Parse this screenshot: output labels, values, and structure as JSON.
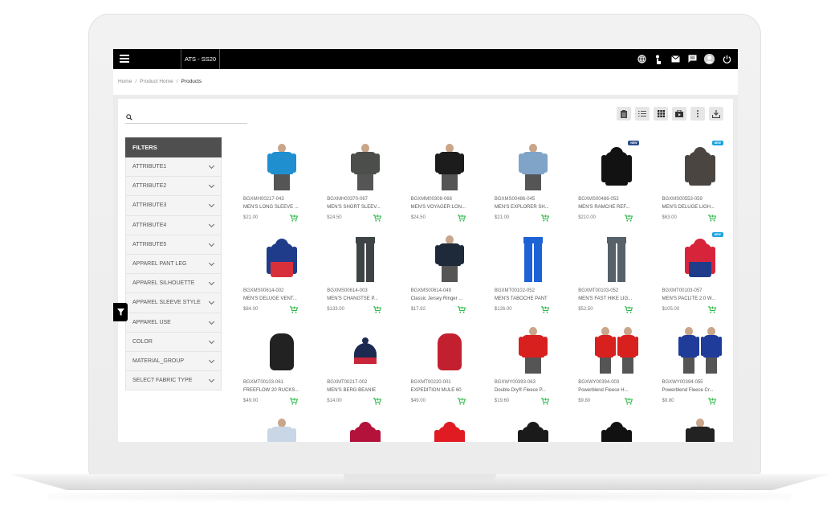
{
  "topbar": {
    "season": "ATS - SS20",
    "icons": [
      "globe-icon",
      "touch-icon",
      "mail-icon",
      "chat-icon",
      "avatar",
      "power-icon"
    ]
  },
  "breadcrumb": {
    "items": [
      "Home",
      "Product Home"
    ],
    "current": "Products"
  },
  "search": {
    "placeholder": "",
    "value": ""
  },
  "toolbar": {
    "buttons": [
      "clipboard-view",
      "list-view",
      "grid-view",
      "media-view",
      "more-options",
      "download"
    ]
  },
  "filters": {
    "title": "FILTERS",
    "items": [
      "ATTRIBUTE1",
      "ATTRIBUTE2",
      "ATTRIBUTE3",
      "ATTRIBUTE4",
      "ATTRIBUTE5",
      "APPAREL PANT LEG",
      "APPAREL SILHOUETTE",
      "APPAREL SLEEVE STYLE",
      "APPAREL USE",
      "COLOR",
      "MATERIAL_GROUP",
      "SELECT FABRIC TYPE"
    ]
  },
  "colors": {
    "topbar": "#000000",
    "filters_header": "#4f4f4f",
    "cart_green": "#2fb84a",
    "badge_navy": "#2b4e8c",
    "badge_blue": "#1aa3e0"
  },
  "products": [
    {
      "sku": "BGXMH00217-043",
      "name": "MEN'S LONG SLEEVE ...",
      "price": "$21.00",
      "kind": "person",
      "color": "#1f8fd0"
    },
    {
      "sku": "BGXMH00370-067",
      "name": "MEN'S SHORT SLEEV...",
      "price": "$24.50",
      "kind": "person",
      "color": "#4b4e4a"
    },
    {
      "sku": "BGXMM00308-066",
      "name": "MEN'S VOYAGER LON...",
      "price": "$24.50",
      "kind": "person",
      "color": "#1c1c1c"
    },
    {
      "sku": "BGXMS00486-045",
      "name": "MEN'S EXPLORER SH...",
      "price": "$21.00",
      "kind": "person",
      "color": "#7fa4c8"
    },
    {
      "sku": "BGXMS00486-053",
      "name": "MEN'S RAMCHE REF...",
      "price": "$210.00",
      "kind": "jacket",
      "color": "#121212",
      "badge": "NEW"
    },
    {
      "sku": "BGXMS00553-059",
      "name": "MEN'S DELUGE LIGH...",
      "price": "$63.00",
      "kind": "jacket",
      "color": "#4a4541",
      "badge": "NEW"
    },
    {
      "sku": "BGXMS00614-002",
      "name": "MEN'S DELUGE VENT...",
      "price": "$84.00",
      "kind": "jacket",
      "color": "#1f3c8a",
      "color2": "#d8303a"
    },
    {
      "sku": "BGXMS00614-003",
      "name": "MEN'S CHANGTSE P...",
      "price": "$133.00",
      "kind": "pant",
      "color": "#3e4446"
    },
    {
      "sku": "BGXMS00614-049",
      "name": "Classic Jersey Ringer ...",
      "price": "$17.92",
      "kind": "person",
      "color": "#1e2a3a"
    },
    {
      "sku": "BGXMT00102-052",
      "name": "MEN'S TABOCHE PANT",
      "price": "$126.00",
      "kind": "pant",
      "color": "#1e63d6"
    },
    {
      "sku": "BGXMT00103-052",
      "name": "MEN'S FAST HIKE LIG...",
      "price": "$52.50",
      "kind": "pant",
      "color": "#56616a"
    },
    {
      "sku": "BGXMT00103-057",
      "name": "MEN'S PACLITE 2.0 W...",
      "price": "$105.00",
      "kind": "jacket",
      "color": "#d8243a",
      "color2": "#1f3c8a",
      "badge": "NEW"
    },
    {
      "sku": "BGXMT00103-061",
      "name": "FREEFLOW 20 RUCKS...",
      "price": "$49.00",
      "kind": "bag",
      "color": "#222222"
    },
    {
      "sku": "BGXMT00217-002",
      "name": "MEN'S BERG BEANIE",
      "price": "$14.00",
      "kind": "beanie",
      "color": "#1c2a52",
      "color2": "#c8263a"
    },
    {
      "sku": "BGXMT00220-001",
      "name": "EXPEDITION MULE 60",
      "price": "$49.00",
      "kind": "bag",
      "color": "#c3202f"
    },
    {
      "sku": "BGXWY00393-063",
      "name": "Double Dry® Fleece P...",
      "price": "$19.60",
      "kind": "person",
      "color": "#d8201f"
    },
    {
      "sku": "BGXWY00394-003",
      "name": "Powerblend Fleece H...",
      "price": "$9.80",
      "kind": "duo",
      "color": "#d8201f"
    },
    {
      "sku": "BGXWY00394-055",
      "name": "Powerblend Fleece Cr...",
      "price": "$9.80",
      "kind": "duo",
      "color": "#1f3c9a"
    },
    {
      "sku": "",
      "name": "",
      "price": "",
      "kind": "person",
      "color": "#c9d6e6"
    },
    {
      "sku": "",
      "name": "",
      "price": "",
      "kind": "jacket",
      "color": "#b3123a"
    },
    {
      "sku": "",
      "name": "",
      "price": "",
      "kind": "jacket",
      "color": "#e01b22"
    },
    {
      "sku": "",
      "name": "",
      "price": "",
      "kind": "jacket",
      "color": "#1a1a1a"
    },
    {
      "sku": "",
      "name": "",
      "price": "",
      "kind": "jacket",
      "color": "#111111"
    },
    {
      "sku": "",
      "name": "",
      "price": "",
      "kind": "person",
      "color": "#222222"
    }
  ]
}
